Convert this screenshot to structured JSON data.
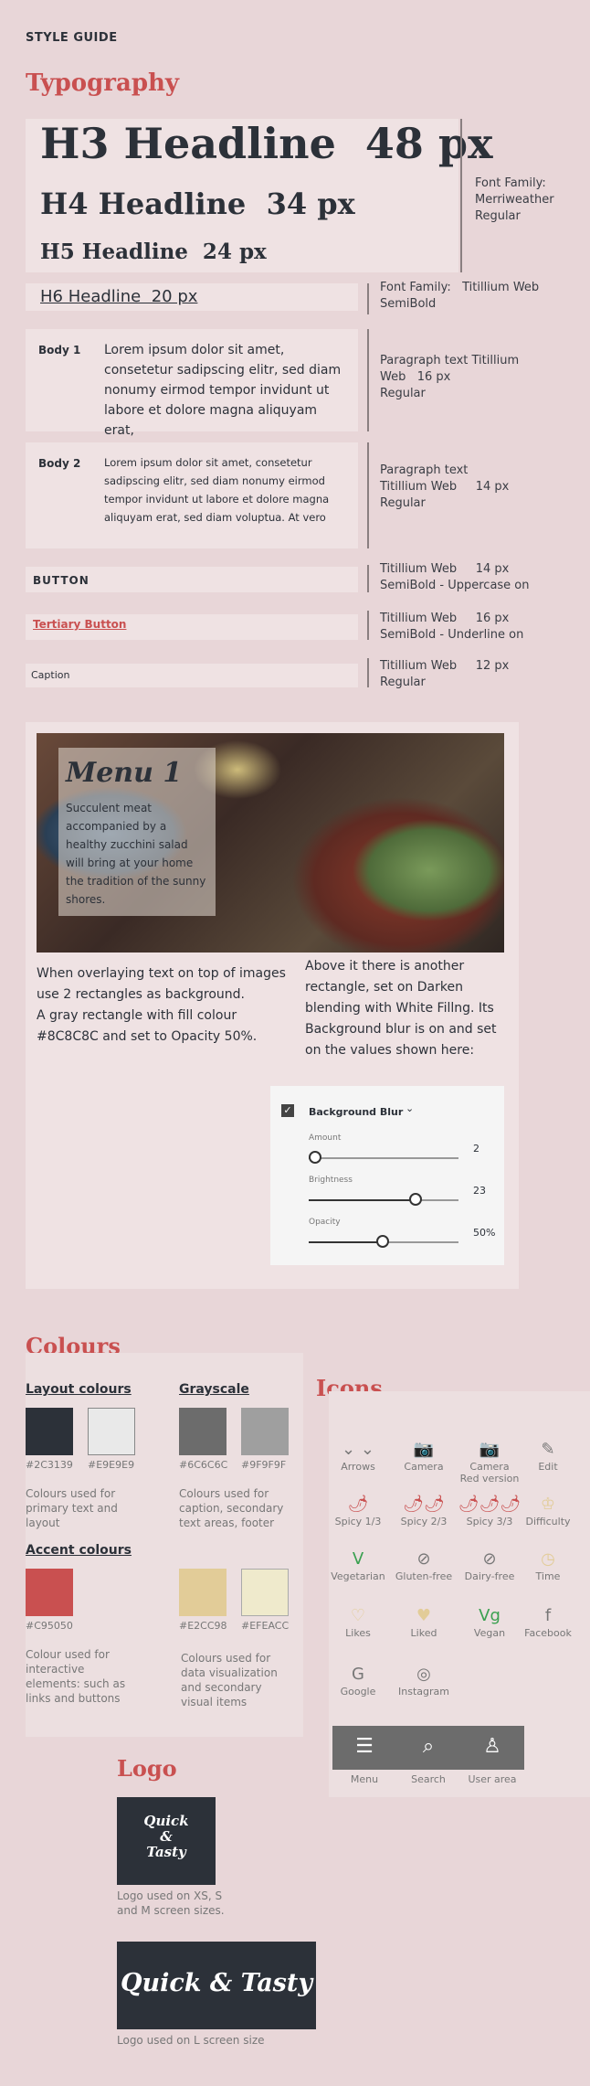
{
  "header": {
    "style_guide": "STYLE GUIDE"
  },
  "typography": {
    "title": "Typography",
    "h3": "H3 Headline  48 px",
    "h4": "H4 Headline  34 px",
    "h5": "H5 Headline  24 px",
    "h6": "H6 Headline  20 px",
    "font_family_merriweather": "Font Family:\nMerriweather\nRegular",
    "font_family_titillium": "Font Family:   Titillium Web\nSemiBold",
    "body1_label": "Body 1",
    "body1_text": "Lorem ipsum dolor sit amet, consetetur sadipscing elitr, sed diam nonumy eirmod tempor invidunt ut labore et dolore magna aliquyam erat,",
    "body1_spec": "Paragraph text Titillium\nWeb   16 px\nRegular",
    "body2_label": "Body 2",
    "body2_text": "Lorem ipsum dolor sit amet, consetetur sadipscing elitr, sed diam nonumy eirmod tempor invidunt ut labore et dolore magna aliquyam erat, sed diam voluptua. At vero",
    "body2_spec": "Paragraph text\nTitillium Web     14 px\nRegular",
    "button_label": "BUTTON",
    "button_spec": "Titillium Web     14 px\nSemiBold - Uppercase on",
    "tertiary_label": "Tertiary Button",
    "tertiary_spec": "Titillium Web     16 px\nSemiBold - Underline on",
    "caption_label": "Caption",
    "caption_spec": "Titillium Web     12 px\nRegular"
  },
  "menu_card": {
    "title": "Menu 1",
    "text": "Succulent meat accompanied by a healthy zucchini salad will bring at your home the tradition of the sunny shores.",
    "left_note": "When overlaying text on top of images use 2 rectangles as background.\nA gray rectangle with fill colour #8C8C8C and set to Opacity 50%.",
    "right_note": "Above it there is another rectangle, set on Darken blending with White Fillng. Its Background blur is on and set on the values shown here:",
    "blur_panel": {
      "title": "Background Blur",
      "amount_label": "Amount",
      "amount_value": "2",
      "amount_level": 0.05,
      "brightness_label": "Brightness",
      "brightness_value": "23",
      "brightness_level": 0.72,
      "opacity_label": "Opacity",
      "opacity_value": "50%",
      "opacity_level": 0.5
    }
  },
  "colours": {
    "title": "Colours",
    "layout_heading": "Layout colours",
    "grayscale_heading": "Grayscale",
    "accent_heading": "Accent colours",
    "layout_1": "#2C3139",
    "layout_2": "#E9E9E9",
    "gray_1": "#6C6C6C",
    "gray_2": "#9F9F9F",
    "accent_1": "#C95050",
    "accent_2": "#E2CC98",
    "accent_3": "#EFEACC",
    "layout_desc": "Colours used for primary text and layout",
    "gray_desc": "Colours used for caption, secondary text areas, footer",
    "accent_desc": "Colour used for interactive elements: such as links and buttons",
    "data_desc": "Colours used for data visualization and secondary visual items"
  },
  "icons": {
    "title": "Icons",
    "items": [
      {
        "label": "Arrows",
        "glyph": "⌄  ⌄"
      },
      {
        "label": "Camera",
        "glyph": "📷"
      },
      {
        "label": "Camera\nRed version",
        "glyph": "📷"
      },
      {
        "label": "Edit",
        "glyph": "✎"
      },
      {
        "label": "Spicy 1/3",
        "glyph": "🌶"
      },
      {
        "label": "Spicy 2/3",
        "glyph": "🌶🌶"
      },
      {
        "label": "Spicy 3/3",
        "glyph": "🌶🌶🌶"
      },
      {
        "label": "Difficulty",
        "glyph": "♔"
      },
      {
        "label": "Vegetarian",
        "glyph": "V"
      },
      {
        "label": "Gluten-free",
        "glyph": "⊘"
      },
      {
        "label": "Dairy-free",
        "glyph": "⊘"
      },
      {
        "label": "Time",
        "glyph": "◷"
      },
      {
        "label": "Likes",
        "glyph": "♡"
      },
      {
        "label": "Liked",
        "glyph": "♥"
      },
      {
        "label": "Vegan",
        "glyph": "Vg"
      },
      {
        "label": "Facebook",
        "glyph": "f"
      },
      {
        "label": "Google",
        "glyph": "G"
      },
      {
        "label": "Instagram",
        "glyph": "◎"
      }
    ],
    "nav": [
      {
        "label": "Menu",
        "glyph": "☰"
      },
      {
        "label": "Search",
        "glyph": "⌕"
      },
      {
        "label": "User area",
        "glyph": "♙"
      }
    ]
  },
  "logo": {
    "title": "Logo",
    "small_text": "Quick\n&\nTasty",
    "small_desc": "Logo used on XS, S\nand M screen sizes.",
    "large_text": "Quick & Tasty",
    "large_desc": "Logo used on L screen size"
  }
}
